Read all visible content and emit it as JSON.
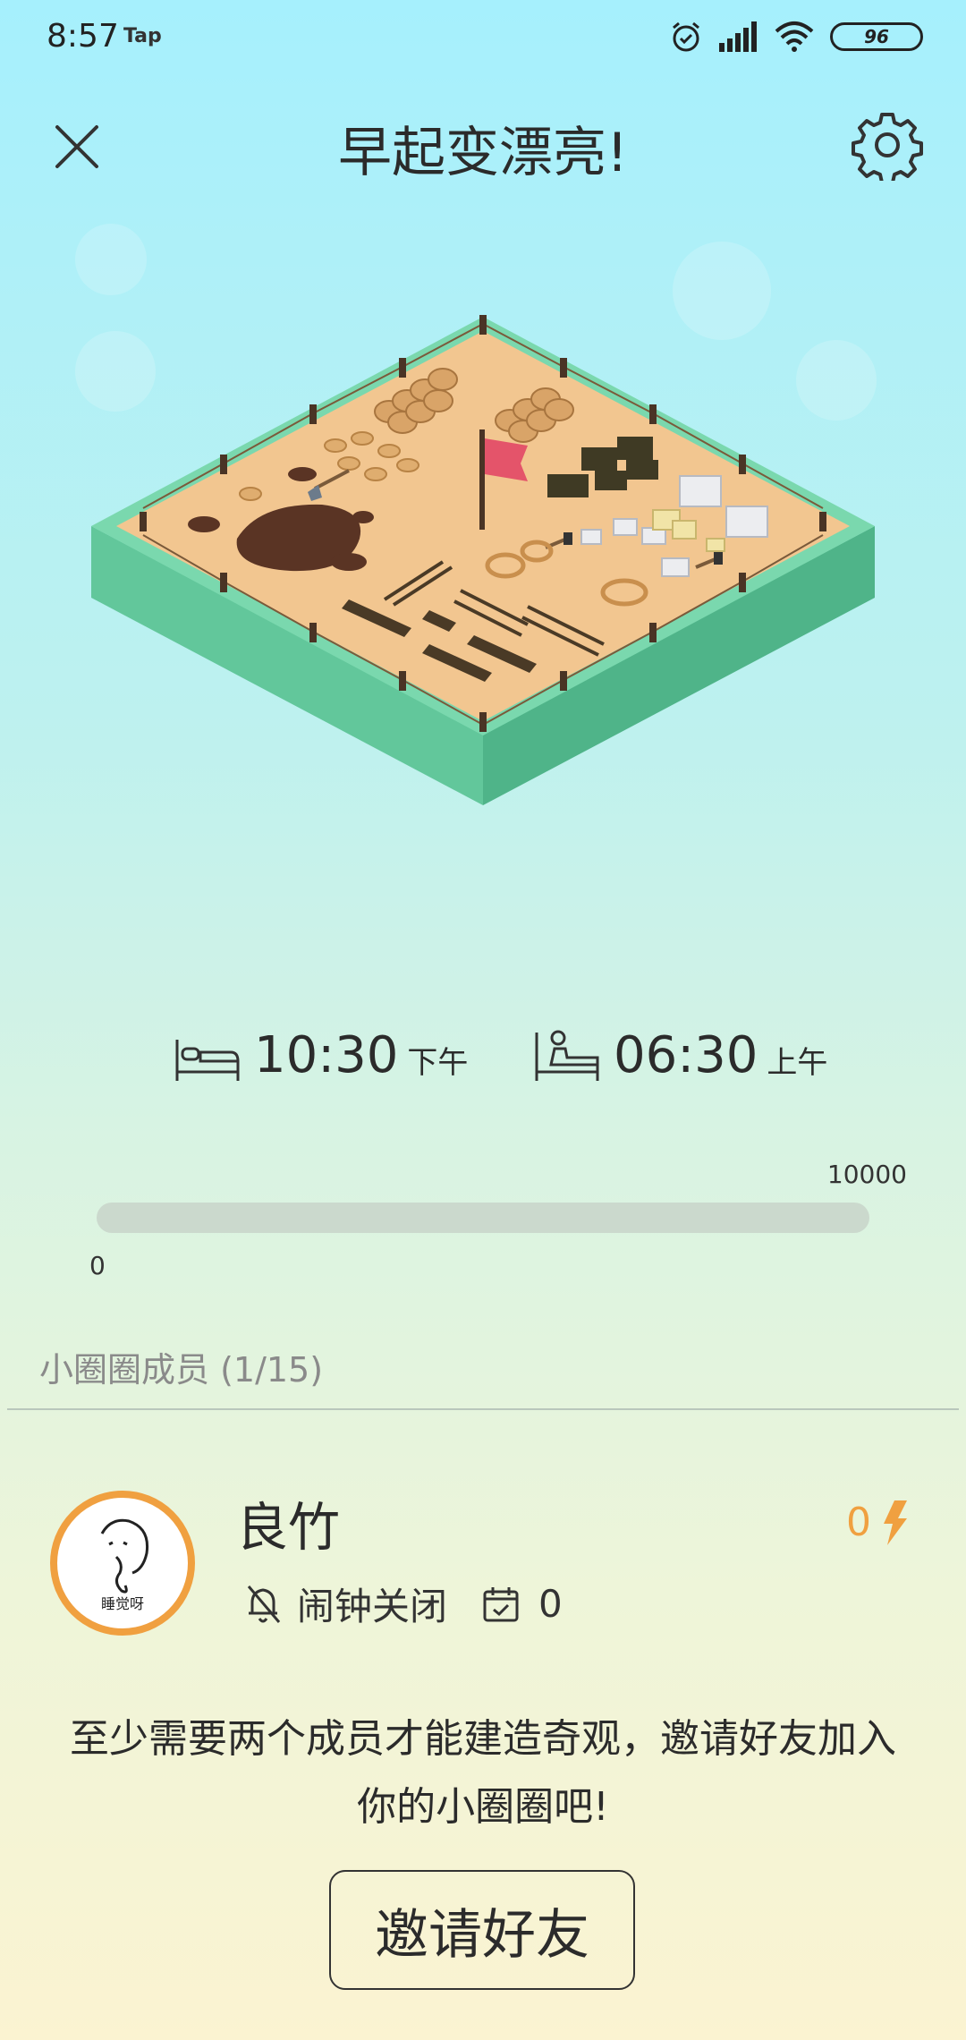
{
  "status_bar": {
    "time": "8:57",
    "tap_label": "Tap",
    "battery": "96",
    "icons": [
      "alarm-icon",
      "signal-icon",
      "wifi-icon",
      "battery-icon"
    ]
  },
  "header": {
    "title": "早起变漂亮!",
    "close_icon": "close-icon",
    "settings_icon": "gear-icon"
  },
  "schedule": {
    "bedtime": {
      "time": "10:30",
      "period": "下午",
      "icon": "bed-icon"
    },
    "wake": {
      "time": "06:30",
      "period": "上午",
      "icon": "wake-up-icon"
    }
  },
  "progress": {
    "min_label": "0",
    "max_label": "10000",
    "value_fraction": 0
  },
  "members": {
    "title": "小圈圈成员 (1/15)",
    "items": [
      {
        "name": "良竹",
        "alarm_status": "闹钟关闭",
        "checkin_count": "0",
        "energy": "0",
        "avatar_text": "睡觉呀"
      }
    ]
  },
  "notice": {
    "line1": "至少需要两个成员才能建造奇观，邀请好友加入",
    "line2": "你的小圈圈吧!"
  },
  "invite_button": {
    "label": "邀请好友"
  },
  "colors": {
    "accent": "#f0a040",
    "grass": "#6fd0a5",
    "sand": "#f2c690",
    "track": "#cbd9cd"
  }
}
